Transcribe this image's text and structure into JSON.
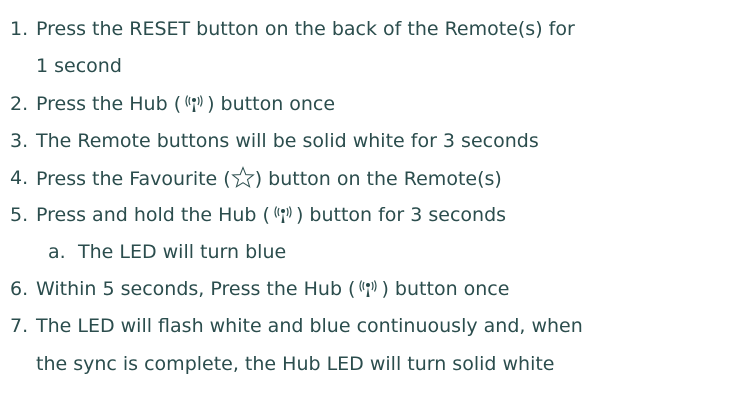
{
  "steps": [
    {
      "num": "1.",
      "text": "Press the RESET button on the back of the Remote(s) for",
      "cont": "1 second"
    },
    {
      "num": "2.",
      "pre": "Press the Hub (",
      "icon": "hub-icon",
      "post": ") button once"
    },
    {
      "num": "3.",
      "text": "The Remote buttons will be solid white for 3 seconds"
    },
    {
      "num": "4.",
      "pre": "Press the Favourite (",
      "icon": "star-outline-icon",
      "post": ") button on the Remote(s)"
    },
    {
      "num": "5.",
      "pre": "Press and hold the Hub (",
      "icon": "hub-icon",
      "post": ") button for 3 seconds"
    },
    {
      "num": "a.",
      "text": "The LED will turn blue"
    },
    {
      "num": "6.",
      "pre": "Within 5 seconds, Press the Hub (",
      "icon": "hub-icon",
      "post": ") button once"
    },
    {
      "num": "7.",
      "text": "The LED will flash white and blue continuously and, when",
      "cont": "the sync is complete, the Hub LED will turn solid white"
    }
  ]
}
